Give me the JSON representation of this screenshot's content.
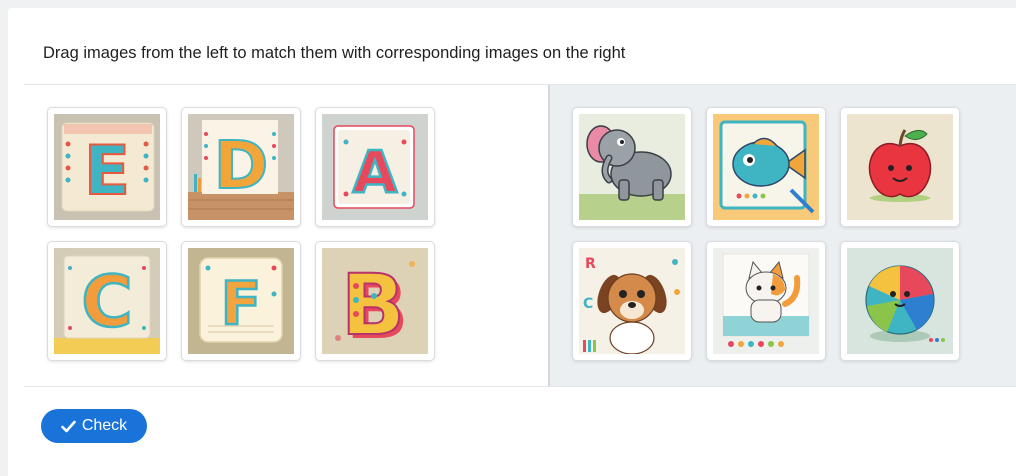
{
  "instructions": "Drag images from the left to match them with corresponding images on the right",
  "left_items": [
    {
      "letter": "E",
      "icon": "letter-e-tile",
      "bg": "#c9c2b3",
      "fill": "#3fb4c2"
    },
    {
      "letter": "D",
      "icon": "letter-d-tile",
      "bg": "#cfc8bc",
      "fill": "#f2a63a"
    },
    {
      "letter": "A",
      "icon": "letter-a-tile",
      "bg": "#cfd3d0",
      "fill": "#e8485b"
    },
    {
      "letter": "C",
      "icon": "letter-c-tile",
      "bg": "#d3cdb7",
      "fill": "#f29c3c"
    },
    {
      "letter": "F",
      "icon": "letter-f-tile",
      "bg": "#c2b591",
      "fill": "#f3a43e"
    },
    {
      "letter": "B",
      "icon": "letter-b-tile",
      "bg": "#ddd2b6",
      "fill": "#f4c23e"
    }
  ],
  "right_items": [
    {
      "icon": "elephant-icon",
      "bg": "#e8ede0"
    },
    {
      "icon": "fish-icon",
      "bg": "#f7c979"
    },
    {
      "icon": "apple-icon",
      "bg": "#ece4cf"
    },
    {
      "icon": "dog-icon",
      "bg": "#f6f1e6"
    },
    {
      "icon": "cat-icon",
      "bg": "#eef0ee"
    },
    {
      "icon": "ball-icon",
      "bg": "#d8e5de"
    }
  ],
  "check_button": {
    "label": "Check",
    "icon": "check-icon"
  },
  "colors": {
    "primary": "#1a73d9",
    "pane_right_bg": "#eceff2"
  }
}
